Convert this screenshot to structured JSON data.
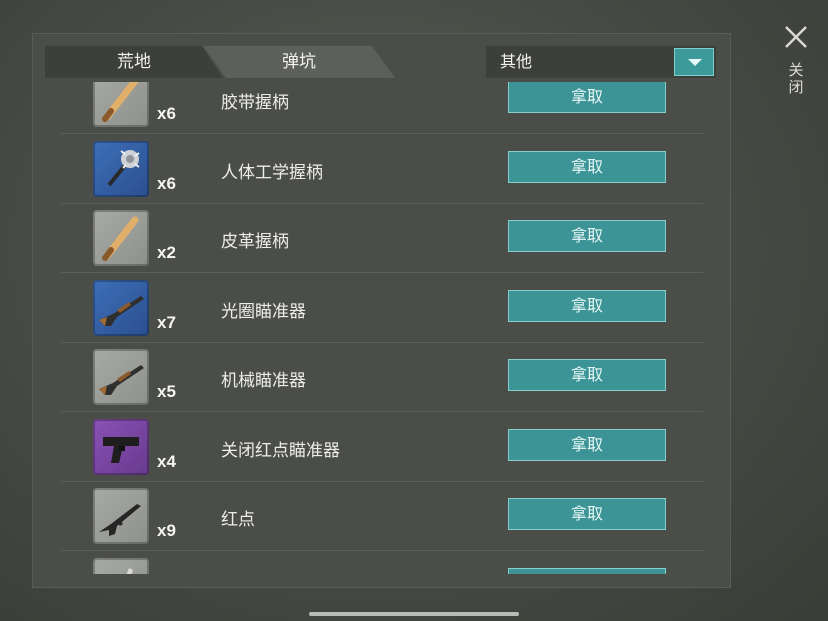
{
  "tabs": [
    {
      "label": "荒地"
    },
    {
      "label": "弹坑"
    }
  ],
  "dropdown": {
    "selected": "其他"
  },
  "close": {
    "label": "关闭"
  },
  "items": [
    {
      "name": "胶带握柄",
      "qty": "x6",
      "take": "拿取",
      "rarity": "grey",
      "icon": "bat-icon"
    },
    {
      "name": "人体工学握柄",
      "qty": "x6",
      "take": "拿取",
      "rarity": "blue",
      "icon": "spiked-club-icon"
    },
    {
      "name": "皮革握柄",
      "qty": "x2",
      "take": "拿取",
      "rarity": "grey",
      "icon": "bat-icon"
    },
    {
      "name": "光圈瞄准器",
      "qty": "x7",
      "take": "拿取",
      "rarity": "blue",
      "icon": "shotgun-icon"
    },
    {
      "name": "机械瞄准器",
      "qty": "x5",
      "take": "拿取",
      "rarity": "grey",
      "icon": "shotgun-icon"
    },
    {
      "name": "关闭红点瞄准器",
      "qty": "x4",
      "take": "拿取",
      "rarity": "purple",
      "icon": "pistol-icon"
    },
    {
      "name": "红点",
      "qty": "x9",
      "take": "拿取",
      "rarity": "grey",
      "icon": "rifle-icon"
    },
    {
      "name": "",
      "qty": "",
      "take": "",
      "rarity": "grey",
      "icon": "knife-icon"
    }
  ],
  "colors": {
    "accent": "#3c9496",
    "grey": "#9c9e9a",
    "blue": "#3563a8",
    "purple": "#7a47a4"
  }
}
